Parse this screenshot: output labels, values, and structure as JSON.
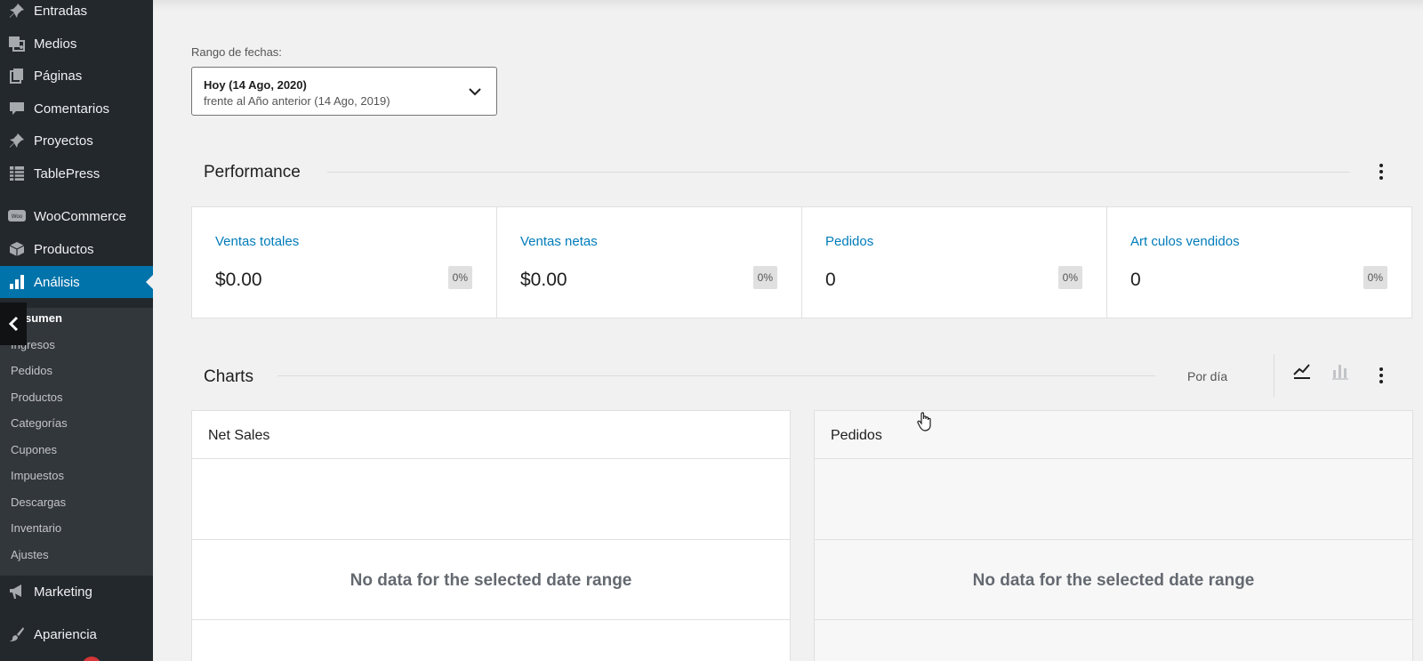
{
  "sidebar": {
    "menu": [
      {
        "label": "Entradas",
        "icon": "pin-icon"
      },
      {
        "label": "Medios",
        "icon": "media-icon"
      },
      {
        "label": "Páginas",
        "icon": "pages-icon"
      },
      {
        "label": "Comentarios",
        "icon": "comment-icon"
      },
      {
        "label": "Proyectos",
        "icon": "pin-icon"
      },
      {
        "label": "TablePress",
        "icon": "table-icon"
      },
      {
        "label": "WooCommerce",
        "icon": "woo-icon"
      },
      {
        "label": "Productos",
        "icon": "box-icon"
      },
      {
        "label": "Análisis",
        "icon": "bar-chart-icon",
        "active": true
      },
      {
        "label": "Marketing",
        "icon": "megaphone-icon"
      },
      {
        "label": "Apariencia",
        "icon": "brush-icon"
      }
    ],
    "submenu": [
      {
        "label": "sumen",
        "current": true
      },
      {
        "label": "Ingresos"
      },
      {
        "label": "Pedidos"
      },
      {
        "label": "Productos"
      },
      {
        "label": "Categorías"
      },
      {
        "label": "Cupones"
      },
      {
        "label": "Impuestos"
      },
      {
        "label": "Descargas"
      },
      {
        "label": "Inventario"
      },
      {
        "label": "Ajustes"
      }
    ]
  },
  "date_range": {
    "label": "Rango de fechas:",
    "primary": "Hoy (14 Ago, 2020)",
    "secondary": "frente al Año anterior (14 Ago, 2019)"
  },
  "performance": {
    "title": "Performance",
    "cards": [
      {
        "label": "Ventas totales",
        "value": "$0.00",
        "delta": "0%"
      },
      {
        "label": "Ventas netas",
        "value": "$0.00",
        "delta": "0%"
      },
      {
        "label": "Pedidos",
        "value": "0",
        "delta": "0%"
      },
      {
        "label": "Art culos vendidos",
        "value": "0",
        "delta": "0%"
      }
    ]
  },
  "charts": {
    "title": "Charts",
    "interval": "Por día",
    "selected_type": "line",
    "cards": [
      {
        "title": "Net Sales",
        "empty": "No data for the selected date range"
      },
      {
        "title": "Pedidos",
        "empty": "No data for the selected date range"
      }
    ]
  },
  "colors": {
    "sidebar_bg": "#23282d",
    "submenu_bg": "#32373c",
    "active_bg": "#0073aa",
    "link": "#007cba"
  }
}
